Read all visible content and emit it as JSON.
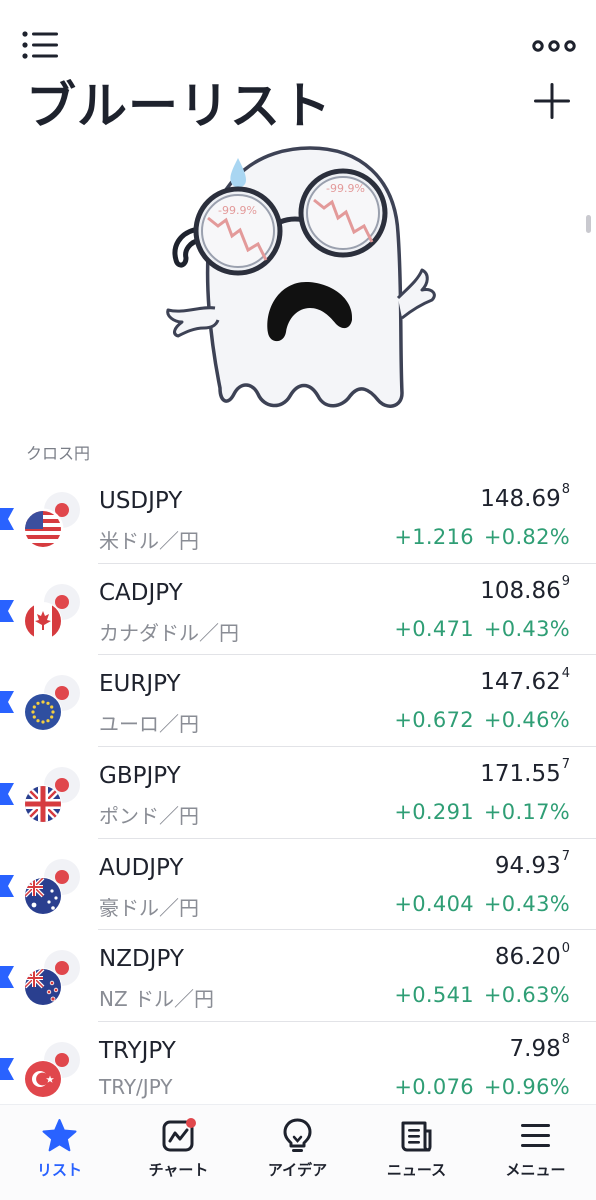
{
  "header": {
    "title": "ブルーリスト"
  },
  "section": {
    "label": "クロス円"
  },
  "illustration": {
    "badge_left": "-99.9%",
    "badge_right": "-99.9%"
  },
  "rows": [
    {
      "symbol": "USDJPY",
      "description": "米ドル／円",
      "price_main": "148.69",
      "price_sup": "8",
      "change": "+1.216",
      "change_pct": "+0.82%",
      "flag": "us-flag-icon"
    },
    {
      "symbol": "CADJPY",
      "description": "カナダドル／円",
      "price_main": "108.86",
      "price_sup": "9",
      "change": "+0.471",
      "change_pct": "+0.43%",
      "flag": "canada-flag-icon"
    },
    {
      "symbol": "EURJPY",
      "description": "ユーロ／円",
      "price_main": "147.62",
      "price_sup": "4",
      "change": "+0.672",
      "change_pct": "+0.46%",
      "flag": "eu-flag-icon"
    },
    {
      "symbol": "GBPJPY",
      "description": "ポンド／円",
      "price_main": "171.55",
      "price_sup": "7",
      "change": "+0.291",
      "change_pct": "+0.17%",
      "flag": "uk-flag-icon"
    },
    {
      "symbol": "AUDJPY",
      "description": "豪ドル／円",
      "price_main": "94.93",
      "price_sup": "7",
      "change": "+0.404",
      "change_pct": "+0.43%",
      "flag": "australia-flag-icon"
    },
    {
      "symbol": "NZDJPY",
      "description": "NZ ドル／円",
      "price_main": "86.20",
      "price_sup": "0",
      "change": "+0.541",
      "change_pct": "+0.63%",
      "flag": "new-zealand-flag-icon"
    },
    {
      "symbol": "TRYJPY",
      "description": "TRY/JPY",
      "price_main": "7.98",
      "price_sup": "8",
      "change": "+0.076",
      "change_pct": "+0.96%",
      "flag": "turkey-flag-icon"
    }
  ],
  "tabs": [
    {
      "label": "リスト",
      "icon": "star-icon",
      "active": true
    },
    {
      "label": "チャート",
      "icon": "chart-icon",
      "active": false
    },
    {
      "label": "アイデア",
      "icon": "lightbulb-icon",
      "active": false
    },
    {
      "label": "ニュース",
      "icon": "news-icon",
      "active": false
    },
    {
      "label": "メニュー",
      "icon": "menu-icon",
      "active": false
    }
  ],
  "colors": {
    "accent": "#2962ff",
    "positive": "#2f9e75",
    "marker": "#2962ff",
    "jp_red": "#e0474c"
  }
}
